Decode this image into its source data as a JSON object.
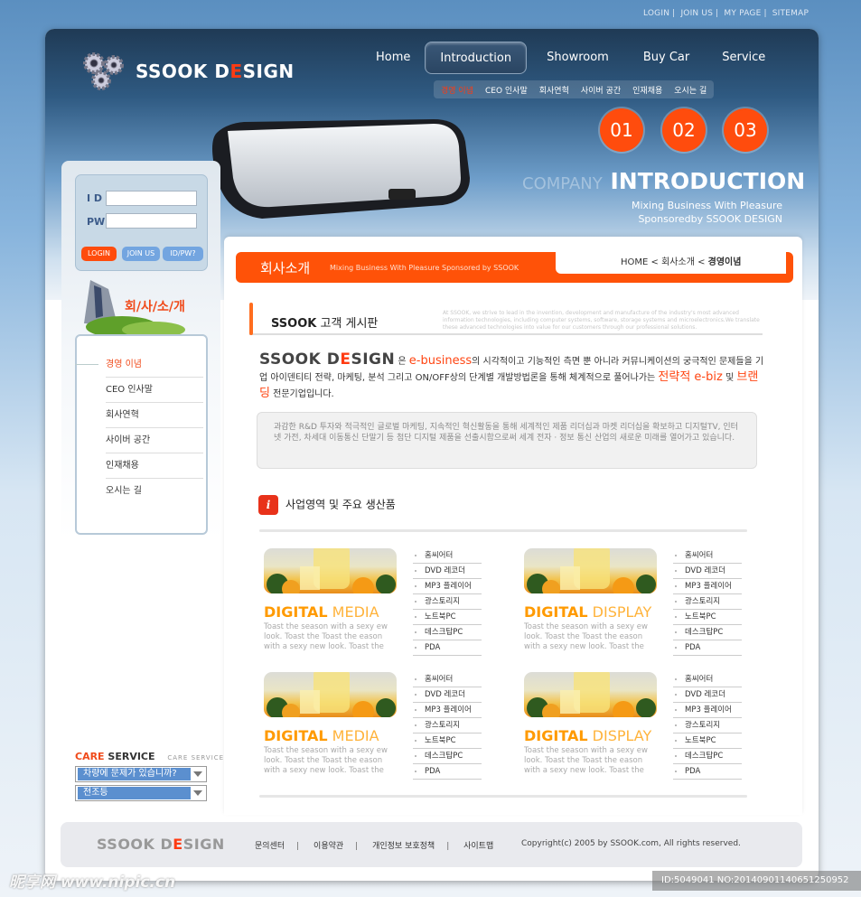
{
  "top_links": [
    "LOGIN",
    "JOIN US",
    "MY PAGE",
    "SITEMAP"
  ],
  "brand": {
    "pre": "SSOOK D",
    "e": "E",
    "post": "SIGN"
  },
  "nav": [
    {
      "label": "Home"
    },
    {
      "label": "Introduction",
      "active": true
    },
    {
      "label": "Showroom"
    },
    {
      "label": "Buy Car"
    },
    {
      "label": "Service"
    }
  ],
  "subnav": [
    "경영 이념",
    "CEO 인사말",
    "회사연혁",
    "사이버 공간",
    "인재채용",
    "오시는 길"
  ],
  "circles": [
    "01",
    "02",
    "03"
  ],
  "hero": {
    "title_light": "COMPANY",
    "title_bold": "INTRODUCTION",
    "sub1": "Mixing Business With Pleasure",
    "sub2": "Sponsoredby SSOOK DESIGN"
  },
  "login": {
    "id_label": "I D",
    "pw_label": "PW",
    "id_value": "",
    "pw_value": "",
    "login_btn": "LOGIN",
    "join_btn": "JOIN US",
    "find_btn": "ID/PW?"
  },
  "side": {
    "title": "회/사/소/개",
    "items": [
      "경영 이념",
      "CEO 인사말",
      "회사연혁",
      "사이버 공간",
      "인재채용",
      "오시는 길"
    ]
  },
  "care": {
    "title_red": "CARE",
    "title_dark": "SERVICE",
    "title_sub": "CARE SERVICE",
    "select1": "차량에 문제가 있습니까?",
    "select2": "전조등"
  },
  "section": {
    "title": "회사소개",
    "tagline": "Mixing Business With Pleasure Sponsored by SSOOK",
    "breadcrumb": [
      "HOME",
      "회사소개",
      "경영이념"
    ]
  },
  "board": {
    "title_bold": "SSOOK",
    "title_rest": " 고객 게시판",
    "desc": "At SSOOK, we strive to lead in the invention, development and manufacture of the industry's most advanced information technologies, including computer systems, software, storage systems and microelectronics.We translate these advanced technologies into value for our customers through our professional solutions."
  },
  "intro": {
    "t1": " 은 ",
    "hl1": "e-business",
    "t2": "의 시각적이고 기능적인 측면 뿐 아니라 커뮤니케이션의 궁극적인 문제들을 기업 아이덴티티 전략, 마케팅, 분석 그리고 ON/OFF상의 단계별 개발방법론을 통해 체계적으로 풀어나가는 ",
    "hl2": "전략적 e-biz",
    "t3": " 및 ",
    "hl3": "브랜딩",
    "t4": " 전문기업입니다."
  },
  "quote": "과감한 R&D 투자와 적극적인 글로벌 마케팅, 지속적인 혁신활동을 통해 세계적인 제품 리더십과 마켓 리더십을 확보하고 디지털TV, 인터넷 가전, 차세대 이동통신 단말기 등 첨단 디지털 제품을 선출시함으로써 세계 전자 · 정보 통신 산업의 새로운 미래를 열어가고 있습니다.",
  "biz_title": "사업영역 및 주요 생산품",
  "products": [
    {
      "t1": "DIGITAL",
      "t2": " MEDIA",
      "desc": "Toast the season with a sexy ew look. Toast the Toast the eason with a sexy new look. Toast the",
      "items": [
        "홈씨어터",
        "DVD 레코더",
        "MP3 플레이어",
        "광스토리지",
        "노트북PC",
        "데스크탑PC",
        "PDA"
      ]
    },
    {
      "t1": "DIGITAL",
      "t2": " DISPLAY",
      "desc": "Toast the season with a sexy ew look. Toast the Toast the eason with a sexy new look. Toast the",
      "items": [
        "홈씨어터",
        "DVD 레코더",
        "MP3 플레이어",
        "광스토리지",
        "노트북PC",
        "데스크탑PC",
        "PDA"
      ]
    },
    {
      "t1": "DIGITAL",
      "t2": " MEDIA",
      "desc": "Toast the season with a sexy ew look. Toast the Toast the eason with a sexy new look. Toast the",
      "items": [
        "홈씨어터",
        "DVD 레코더",
        "MP3 플레이어",
        "광스토리지",
        "노트북PC",
        "데스크탑PC",
        "PDA"
      ]
    },
    {
      "t1": "DIGITAL",
      "t2": " DISPLAY",
      "desc": "Toast the season with a sexy ew look. Toast the Toast the eason with a sexy new look. Toast the",
      "items": [
        "홈씨어터",
        "DVD 레코더",
        "MP3 플레이어",
        "광스토리지",
        "노트북PC",
        "데스크탑PC",
        "PDA"
      ]
    }
  ],
  "footer": {
    "links": [
      "문의센터",
      "이용약관",
      "개인정보 보호정책",
      "사이트맵"
    ],
    "copyright": "Copyright(c) 2005 by SSOOK.com, All rights reserved."
  },
  "watermark": {
    "left": "昵享网 www.nipic.cn",
    "right": "ID:5049041 NO:20140901140651250952"
  },
  "colors": {
    "accent": "#ff5208",
    "nav_bg": "#1f3a55",
    "select": "#5b8fcf"
  }
}
